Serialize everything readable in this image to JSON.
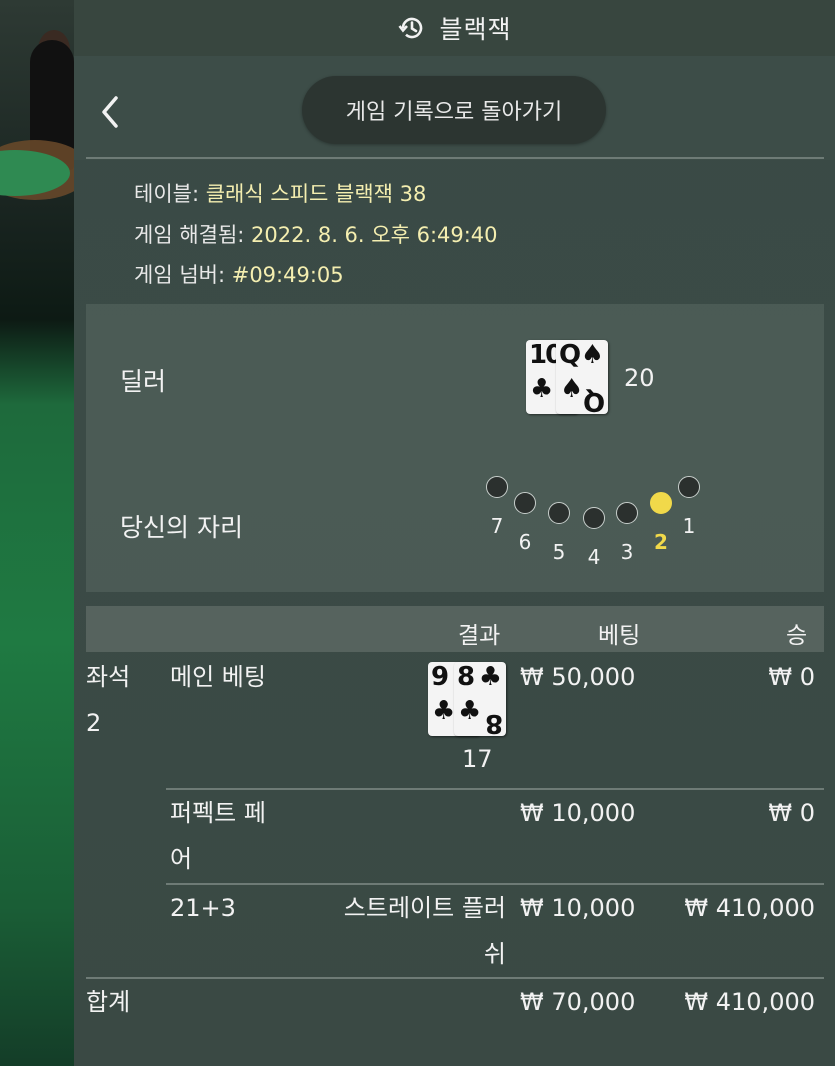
{
  "header": {
    "title": "블랙잭",
    "back_to_history": "게임 기록으로 돌아가기"
  },
  "info": {
    "table_label": "테이블:",
    "table_value": "클래식 스피드 블랙잭 38",
    "resolved_label": "게임 해결됨:",
    "resolved_value": "2022. 8. 6. 오후 6:49:40",
    "number_label": "게임 넘버:",
    "number_value": "#09:49:05"
  },
  "dealer": {
    "label": "딜러",
    "cards": [
      {
        "rank": "10",
        "suit": "♣"
      },
      {
        "rank": "Q",
        "suit": "♠"
      }
    ],
    "total": "20"
  },
  "seat": {
    "label": "당신의 자리",
    "seats": [
      "7",
      "6",
      "5",
      "4",
      "3",
      "2",
      "1"
    ],
    "active": "2"
  },
  "table": {
    "col_result": "결과",
    "col_bet": "베팅",
    "col_win": "승",
    "seat_label_1": "좌석",
    "seat_label_2": "2",
    "rows": [
      {
        "name": "메인 베팅",
        "cards": [
          {
            "rank": "9",
            "suit": "♣"
          },
          {
            "rank": "8",
            "suit": "♣"
          }
        ],
        "result": "17",
        "bet": "₩ 50,000",
        "win": "₩ 0"
      },
      {
        "name_1": "퍼펙트 페",
        "name_2": "어",
        "bet": "₩ 10,000",
        "win": "₩ 0"
      },
      {
        "name": "21+3",
        "result_1": "스트레이트 플러",
        "result_2": "쉬",
        "bet": "₩ 10,000",
        "win": "₩ 410,000"
      }
    ],
    "total_label": "합계",
    "total_bet": "₩ 70,000",
    "total_win": "₩ 410,000"
  }
}
